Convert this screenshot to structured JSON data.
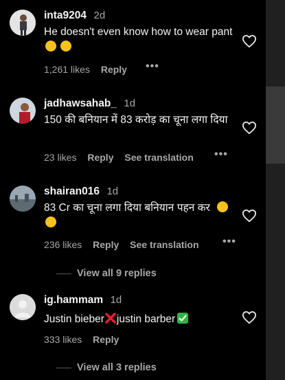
{
  "comments": [
    {
      "username": "inta9204",
      "time": "2d",
      "text": "He doesn't even know how to wear pant",
      "likes": "1,261 likes",
      "reply": "Reply",
      "avatar_icon": "person-photo-avatar"
    },
    {
      "username": "jadhawsahab_",
      "time": "1d",
      "text": "150 की बनियान में 83 करोड़ का चूना लगा दिया",
      "likes": "23 likes",
      "reply": "Reply",
      "translate": "See translation",
      "avatar_icon": "person-photo-avatar"
    },
    {
      "username": "shairan016",
      "time": "1d",
      "text": "83 Cr का चूना लगा दिया बनियान पहन कर",
      "likes": "236 likes",
      "reply": "Reply",
      "translate": "See translation",
      "view_replies": "View all 9 replies",
      "avatar_icon": "landscape-photo-avatar"
    },
    {
      "username": "ig.hammam",
      "time": "1d",
      "text_part1": "Justin bieber",
      "text_part2": "justin barber",
      "likes": "333 likes",
      "reply": "Reply",
      "view_replies": "View all 3 replies",
      "avatar_icon": "default-user-avatar"
    }
  ],
  "more_icon": "ellipsis-icon",
  "like_icon": "heart-outline-icon",
  "colors": {
    "background": "#000000",
    "text": "#f5f5f5",
    "muted": "#a8a8a8"
  }
}
